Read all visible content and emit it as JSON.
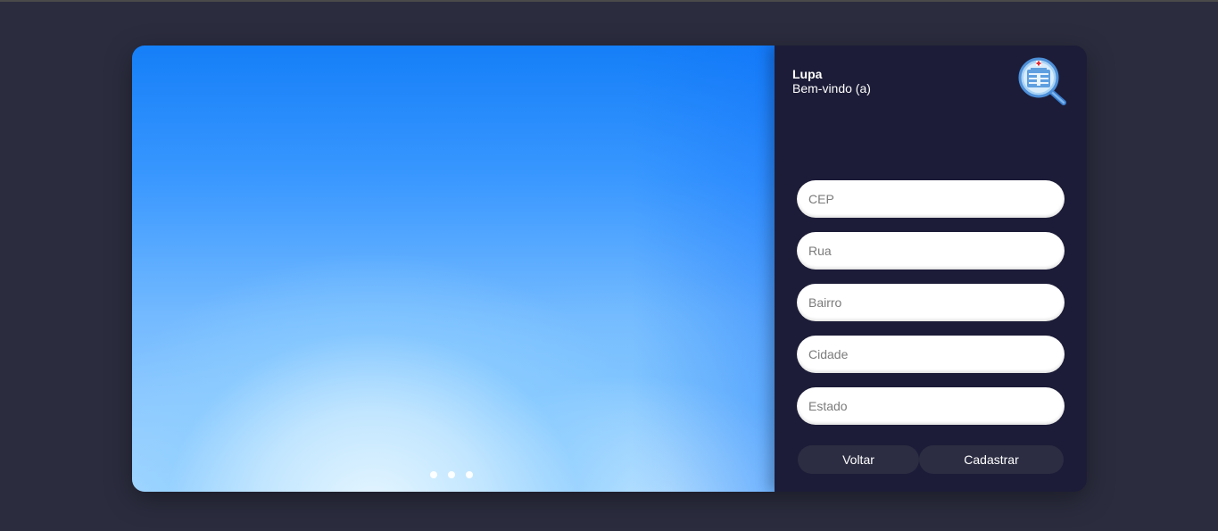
{
  "brand": {
    "name": "Lupa",
    "welcome": "Bem-vindo (a)",
    "logo_icon": "hospital-magnifier-icon"
  },
  "carousel": {
    "slide_count": 3,
    "active_slide": 1
  },
  "form": {
    "fields": [
      {
        "name": "cep",
        "placeholder": "CEP",
        "value": ""
      },
      {
        "name": "rua",
        "placeholder": "Rua",
        "value": ""
      },
      {
        "name": "bairro",
        "placeholder": "Bairro",
        "value": ""
      },
      {
        "name": "cidade",
        "placeholder": "Cidade",
        "value": ""
      },
      {
        "name": "estado",
        "placeholder": "Estado",
        "value": ""
      }
    ],
    "back_label": "Voltar",
    "submit_label": "Cadastrar"
  },
  "colors": {
    "page_background": "#2b2c3e",
    "panel_background": "#1c1c38",
    "button_background": "#2c2d42",
    "hero_blue": "#157ff8"
  }
}
